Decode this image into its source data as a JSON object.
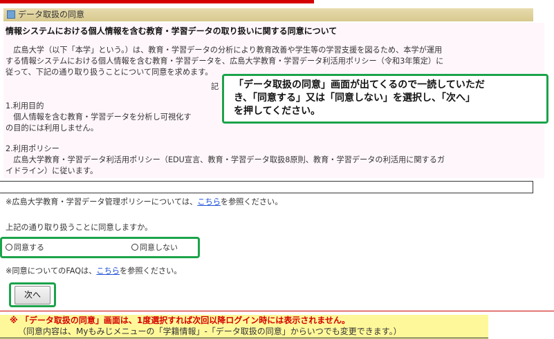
{
  "window": {
    "title": "データ取扱の同意"
  },
  "content": {
    "heading": "情報システムにおける個人情報を含む教育・学習データの取り扱いに関する同意について",
    "intro_lines": [
      "　広島大学（以下「本学」という。）は、教育・学習データの分析により教育改善や学生等の学習支援を図るため、本学が運用",
      "する情報システムにおける個人情報を含む教育・学習データを、広島大学教育・学習データ利活用ポリシー（令和3年策定）に",
      "従って、下記の通り取り扱うことについて同意を求めます。"
    ],
    "ki": "記",
    "section1_title": "1.利用目的",
    "section1_lines": [
      "　個人情報を含む教育・学習データを分析し可視化す",
      "の目的には利用しません。"
    ],
    "section2_title": "2.利用ポリシー",
    "section2_lines": [
      "　広島大学教育・学習データ利活用ポリシー（EDU宣言、教育・学習データ取扱8原則、教育・学習データの利活用に関するガ",
      "イドライン）に従います。"
    ]
  },
  "policy_note": {
    "prefix": "※広島大学教育・学習データ管理ポリシーについては、",
    "link": "こちら",
    "suffix": "を参照ください。"
  },
  "question": "上記の通り取り扱うことに同意しますか。",
  "options": {
    "agree": "同意する",
    "disagree": "同意しない"
  },
  "faq_note": {
    "prefix": "※同意についてのFAQは、",
    "link": "こちら",
    "suffix": "を参照ください。"
  },
  "next_button": "次へ",
  "callout_lines": [
    "「データ取扱の同意」画面が出てくるので一読していただ",
    "き、「同意する」又は「同意しない」を選択し、「次へ」",
    "を押してください。"
  ],
  "notice": {
    "line1": "※ 「データ取扱の同意」画面は、1度選択すれば次回以降ログイン時には表示されません。",
    "line2": "（同意内容は、Myもみじメニューの「学籍情報」-「データ取扱の同意」からいつでも変更できます。）"
  },
  "colors": {
    "accent_red": "#d40000",
    "highlight_green": "#1ba34a",
    "notice_yellow": "#fff89a",
    "title_tan": "#d8c98e"
  }
}
